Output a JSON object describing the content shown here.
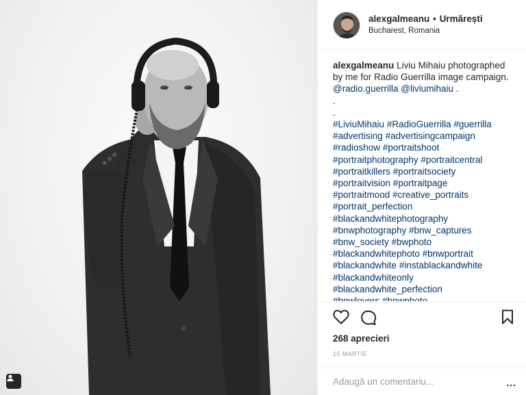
{
  "header": {
    "username": "alexgalmeanu",
    "separator": "•",
    "follow_status": "Urmărești",
    "location": "Bucharest, Romania"
  },
  "caption": {
    "author": "alexgalmeanu",
    "text": "Liviu Mihaiu photographed by me for Radio Guerrilla image campaign.",
    "mention_1": "@radio.guerrilla",
    "mention_2": "@liviumihaiu",
    "trailing": " .",
    "dots": [
      ".",
      "."
    ],
    "hashtag_lines": [
      [
        "#LiviuMihaiu",
        "#RadioGuerrilla",
        "#guerrilla"
      ],
      [
        "#advertising",
        "#advertisingcampaign"
      ],
      [
        "#radioshow",
        "#portraitshoot"
      ],
      [
        "#portraitphotography",
        "#portraitcentral"
      ],
      [
        "#portraitkillers",
        "#portraitsociety"
      ],
      [
        "#portraitvision",
        "#portraitpage"
      ],
      [
        "#portraitmood",
        "#creative_portraits"
      ],
      [
        "#portrait_perfection"
      ],
      [
        "#blackandwhitephotography"
      ],
      [
        "#bnwphotography",
        "#bnw_captures"
      ],
      [
        "#bnw_society",
        "#bwphoto"
      ],
      [
        "#blackandwhitephoto",
        "#bnwportrait"
      ],
      [
        "#blackandwhite",
        "#instablackandwhite"
      ],
      [
        "#blackandwhiteonly"
      ],
      [
        "#blackandwhite_perfection"
      ],
      [
        "#bnwlovers",
        "#bnwphoto"
      ]
    ]
  },
  "actions": {
    "like_icon": "heart-outline-icon",
    "comment_icon": "speech-bubble-icon",
    "save_icon": "bookmark-outline-icon",
    "likes_text": "268 aprecieri",
    "date": "15 MARTIE"
  },
  "comment": {
    "placeholder": "Adaugă un comentariu...",
    "more_label": "..."
  },
  "photo": {
    "user_tag_icon": "person-tag-icon",
    "colors": {
      "background": "#f1f1f1",
      "suit": "#2b2b2b",
      "shirt": "#ffffff",
      "skin": "#b9b9b9"
    }
  }
}
